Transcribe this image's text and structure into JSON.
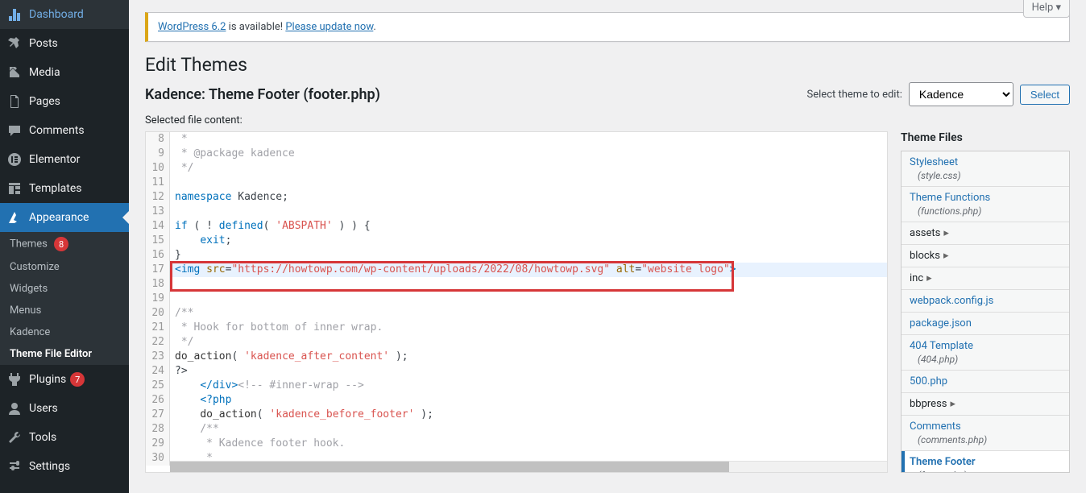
{
  "sidebar": {
    "items": [
      {
        "icon": "dashboard",
        "label": "Dashboard"
      },
      {
        "icon": "pin",
        "label": "Posts"
      },
      {
        "icon": "media",
        "label": "Media"
      },
      {
        "icon": "page",
        "label": "Pages"
      },
      {
        "icon": "comment",
        "label": "Comments"
      },
      {
        "icon": "elementor",
        "label": "Elementor"
      },
      {
        "icon": "templates",
        "label": "Templates"
      },
      {
        "icon": "appearance",
        "label": "Appearance",
        "active": true
      },
      {
        "icon": "plugins",
        "label": "Plugins",
        "badge": "7"
      },
      {
        "icon": "users",
        "label": "Users"
      },
      {
        "icon": "tools",
        "label": "Tools"
      },
      {
        "icon": "settings",
        "label": "Settings"
      }
    ],
    "submenu": [
      {
        "label": "Themes",
        "badge": "8"
      },
      {
        "label": "Customize"
      },
      {
        "label": "Widgets"
      },
      {
        "label": "Menus"
      },
      {
        "label": "Kadence"
      },
      {
        "label": "Theme File Editor",
        "active": true
      }
    ]
  },
  "header": {
    "help": "Help ▾",
    "notice_prefix": "",
    "notice_link1": "WordPress 6.2",
    "notice_mid": " is available! ",
    "notice_link2": "Please update now",
    "notice_suffix": ".",
    "page_title": "Edit Themes",
    "file_title": "Kadence: Theme Footer (footer.php)",
    "select_label": "Select theme to edit:",
    "select_value": "Kadence",
    "select_button": "Select",
    "selected_file": "Selected file content:"
  },
  "code": {
    "lines": [
      {
        "n": "8",
        "html": "c: *"
      },
      {
        "n": "9",
        "html": "c: * @package kadence"
      },
      {
        "n": "10",
        "html": "c: */"
      },
      {
        "n": "11",
        "html": ""
      },
      {
        "n": "12",
        "html": "k:namespace| Kadence;"
      },
      {
        "n": "13",
        "html": ""
      },
      {
        "n": "14",
        "html": "k:if| ( ! |k:defined|( |s:'ABSPATH'| ) ) {"
      },
      {
        "n": "15",
        "html": "    |k:exit|;"
      },
      {
        "n": "16",
        "html": "}"
      },
      {
        "n": "17",
        "html": "t:<img| |a:src|=|s:\"https://howtowp.com/wp-content/uploads/2022/08/howtowp.svg\"| |a:alt|=|s:\"website logo\"|t:>",
        "active": true
      },
      {
        "n": "18",
        "html": ""
      },
      {
        "n": "19",
        "html": ""
      },
      {
        "n": "20",
        "html": "c:/**"
      },
      {
        "n": "21",
        "html": "c: * Hook for bottom of inner wrap."
      },
      {
        "n": "22",
        "html": "c: */"
      },
      {
        "n": "23",
        "html": "f:do_action|( |s:'kadence_after_content'| );"
      },
      {
        "n": "24",
        "html": "?>"
      },
      {
        "n": "25",
        "html": "    |t:</div>|c:<!-- #inner-wrap -->"
      },
      {
        "n": "26",
        "html": "    |t:<?php"
      },
      {
        "n": "27",
        "html": "    |f:do_action|( |s:'kadence_before_footer'| );"
      },
      {
        "n": "28",
        "html": "    |c:/**"
      },
      {
        "n": "29",
        "html": "    |c: * Kadence footer hook."
      },
      {
        "n": "30",
        "html": "    |c: *"
      }
    ]
  },
  "theme_files": {
    "title": "Theme Files",
    "items": [
      {
        "label": "Stylesheet",
        "link": true,
        "sub": "(style.css)"
      },
      {
        "label": "Theme Functions",
        "link": true,
        "sub": "(functions.php)"
      },
      {
        "label": "assets",
        "link": false,
        "arrow": true
      },
      {
        "label": "blocks",
        "link": false,
        "arrow": true
      },
      {
        "label": "inc",
        "link": false,
        "arrow": true
      },
      {
        "label": "webpack.config.js",
        "link": true
      },
      {
        "label": "package.json",
        "link": true
      },
      {
        "label": "404 Template",
        "link": true,
        "sub": "(404.php)"
      },
      {
        "label": "500.php",
        "link": true
      },
      {
        "label": "bbpress",
        "link": false,
        "arrow": true
      },
      {
        "label": "Comments",
        "link": true,
        "sub": "(comments.php)"
      },
      {
        "label": "Theme Footer",
        "link": true,
        "sub": "(footer.php)",
        "active": true
      }
    ]
  }
}
